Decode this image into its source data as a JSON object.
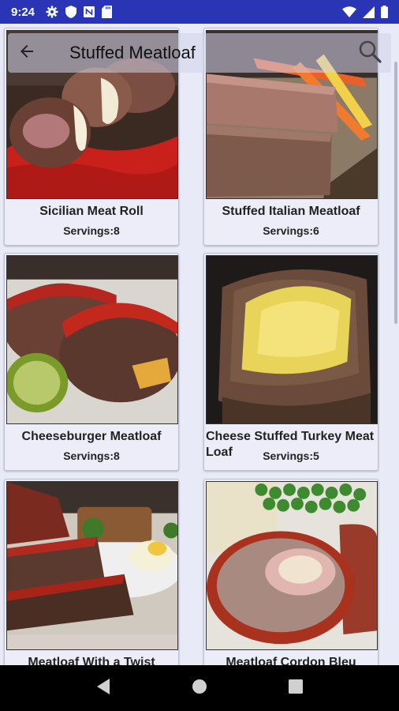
{
  "status_bar": {
    "time": "9:24",
    "left_icons": [
      "gear-icon",
      "shield-icon",
      "nfc-icon",
      "sd-card-icon"
    ],
    "right_icons": [
      "wifi-icon",
      "signal-icon",
      "battery-icon"
    ]
  },
  "header": {
    "title": "Stuffed Meatloaf",
    "back_icon": "arrow-left-icon",
    "search_icon": "search-icon"
  },
  "recipes": [
    {
      "title": "Sicilian Meat Roll",
      "servings": "Servings:8"
    },
    {
      "title": "Stuffed Italian Meatloaf",
      "servings": "Servings:6"
    },
    {
      "title": "Cheeseburger Meatloaf",
      "servings": "Servings:8"
    },
    {
      "title": "Cheese Stuffed Turkey Meat Loaf",
      "servings": "Servings:5"
    },
    {
      "title": "Meatloaf With a Twist",
      "servings": ""
    },
    {
      "title": "Meatloaf Cordon Bleu",
      "servings": ""
    }
  ],
  "colors": {
    "status_bar": "#2A35B5",
    "background": "#E9EAF7",
    "card": "#ECEDF8"
  },
  "nav_bar": {
    "icons": [
      "back-triangle-icon",
      "home-circle-icon",
      "recents-square-icon"
    ]
  }
}
